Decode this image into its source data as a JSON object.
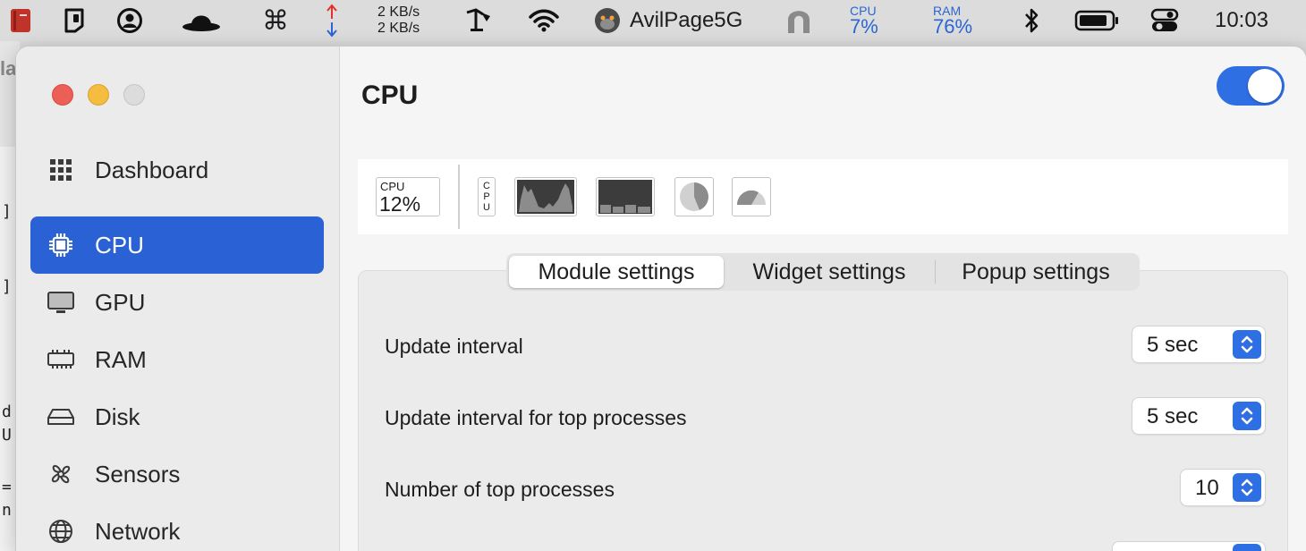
{
  "menubar": {
    "network": {
      "upload": "2 KB/s",
      "download": "2 KB/s"
    },
    "wifi_name": "AvilPage5G",
    "cpu": {
      "label": "CPU",
      "value": "7%"
    },
    "ram": {
      "label": "RAM",
      "value": "76%"
    },
    "clock": "10:03",
    "icons": [
      "book-app-icon",
      "nfc-card-icon",
      "user-circle-icon",
      "bowler-hat-icon",
      "command-icon",
      "network-arrows-icon",
      "desk-lamp-icon",
      "wifi-icon",
      "gorilla-avatar-icon",
      "magnet-icon",
      "bluetooth-icon",
      "battery-icon",
      "control-center-icon"
    ]
  },
  "background_fragments": [
    "la",
    "]",
    "]",
    "d",
    "U",
    "=",
    "n"
  ],
  "sidebar": {
    "items": [
      {
        "label": "Dashboard",
        "icon": "grid-icon",
        "active": false
      },
      {
        "label": "CPU",
        "icon": "cpu-chip-icon",
        "active": true
      },
      {
        "label": "GPU",
        "icon": "monitor-icon",
        "active": false
      },
      {
        "label": "RAM",
        "icon": "memory-icon",
        "active": false
      },
      {
        "label": "Disk",
        "icon": "disk-icon",
        "active": false
      },
      {
        "label": "Sensors",
        "icon": "fan-icon",
        "active": false
      },
      {
        "label": "Network",
        "icon": "globe-icon",
        "active": false
      }
    ]
  },
  "main": {
    "title": "CPU",
    "enabled": true,
    "widgets": {
      "mini": {
        "label": "CPU",
        "value": "12%"
      },
      "text_widget": [
        "C",
        "P",
        "U"
      ]
    },
    "tabs": [
      {
        "label": "Module settings",
        "selected": true
      },
      {
        "label": "Widget settings",
        "selected": false
      },
      {
        "label": "Popup settings",
        "selected": false
      }
    ],
    "settings": [
      {
        "label": "Update interval",
        "value": "5 sec"
      },
      {
        "label": "Update interval for top processes",
        "value": "5 sec"
      },
      {
        "label": "Number of top processes",
        "value": "10"
      }
    ]
  },
  "colors": {
    "accent": "#2a62d5",
    "toggle": "#2f6fe4",
    "menubar_stat": "#2a66d4"
  }
}
